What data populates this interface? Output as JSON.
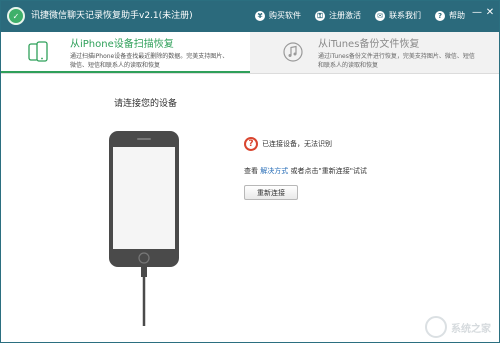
{
  "app": {
    "title": "讯捷微信聊天记录恢复助手v2.1(未注册)",
    "logo_icon": "wechat-recovery-logo-icon"
  },
  "top_menu": [
    {
      "label": "购买软件",
      "icon": "cart-icon"
    },
    {
      "label": "注册激活",
      "icon": "key-icon"
    },
    {
      "label": "联系我们",
      "icon": "mail-icon"
    },
    {
      "label": "帮助",
      "icon": "question-icon"
    }
  ],
  "window_controls": {
    "minimize": "—",
    "close": "✕"
  },
  "tabs": [
    {
      "title": "从iPhone设备扫描恢复",
      "desc": "通过扫描iPhone设备查找最近删除的数据。完美支持图片、微信、短信和联系人的读取和恢复",
      "icon": "iphone-devices-icon",
      "active": true
    },
    {
      "title": "从iTunes备份文件恢复",
      "desc": "通过iTunes备份文件进行恢复，完美支持图片、微信、短信和联系人的读取和恢复",
      "icon": "music-note-icon",
      "active": false
    }
  ],
  "main": {
    "prompt": "请连接您的设备",
    "status_text": "已连接设备，无法识别",
    "help_prefix": "查看",
    "help_link": "解决方式",
    "help_suffix": "或者点击\"重新连接\"试试",
    "reconnect_label": "重新连接",
    "status_color": "#d9452f",
    "accent_color": "#2fa05a",
    "titlebar_color": "#2b6a7c"
  },
  "watermark": {
    "text": "系统之家"
  }
}
